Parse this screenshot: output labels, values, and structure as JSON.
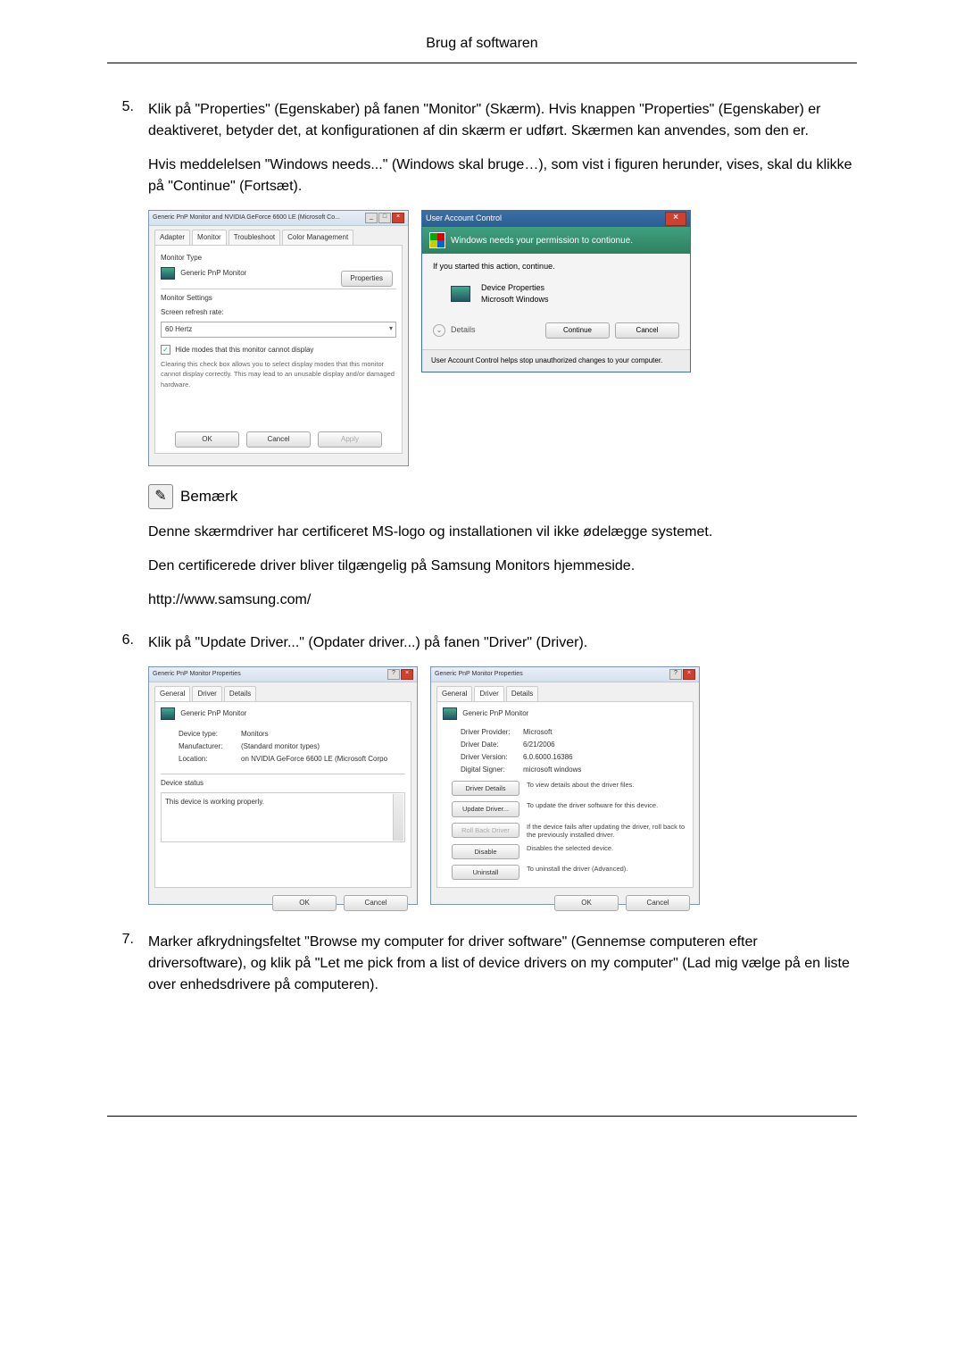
{
  "header": {
    "title": "Brug af softwaren"
  },
  "steps": {
    "s5": {
      "num": "5.",
      "p1": "Klik på \"Properties\" (Egenskaber) på fanen \"Monitor\" (Skærm). Hvis knappen \"Properties\" (Egenskaber) er deaktiveret, betyder det, at konfigurationen af din skærm er udført. Skærmen kan anvendes, som den er.",
      "p2": "Hvis meddelelsen \"Windows needs...\" (Windows skal bruge…), som vist i figuren herunder, vises, skal du klikke på \"Continue\" (Fortsæt)."
    },
    "s6": {
      "num": "6.",
      "p1": "Klik på \"Update Driver...\" (Opdater driver...) på fanen \"Driver\" (Driver)."
    },
    "s7": {
      "num": "7.",
      "p1": "Marker afkrydningsfeltet \"Browse my computer for driver software\" (Gennemse computeren efter driversoftware), og klik på \"Let me pick from a list of device drivers on my computer\" (Lad mig vælge på en liste over enhedsdrivere på computeren)."
    }
  },
  "dlg1": {
    "title": "Generic PnP Monitor and NVIDIA GeForce 6600 LE (Microsoft Co...",
    "tabs": [
      "Adapter",
      "Monitor",
      "Troubleshoot",
      "Color Management"
    ],
    "monitorType": "Monitor Type",
    "monitorName": "Generic PnP Monitor",
    "propertiesBtn": "Properties",
    "monitorSettings": "Monitor Settings",
    "refreshLabel": "Screen refresh rate:",
    "refreshValue": "60 Hertz",
    "hideModes": "Hide modes that this monitor cannot display",
    "hideDesc": "Clearing this check box allows you to select display modes that this monitor cannot display correctly. This may lead to an unusable display and/or damaged hardware.",
    "ok": "OK",
    "cancel": "Cancel",
    "apply": "Apply"
  },
  "uac": {
    "title": "User Account Control",
    "banner": "Windows needs your permission to contionue.",
    "msg": "If you started this action, continue.",
    "appName": "Device Properties",
    "appVendor": "Microsoft Windows",
    "details": "Details",
    "continue": "Continue",
    "cancel": "Cancel",
    "footer": "User Account Control helps stop unauthorized changes to your computer."
  },
  "note": {
    "label": "Bemærk",
    "p1": "Denne skærmdriver har certificeret MS-logo og installationen vil ikke ødelægge systemet.",
    "p2": "Den certificerede driver bliver tilgængelig på Samsung Monitors hjemmeside.",
    "url": "http://www.samsung.com/"
  },
  "dlg2": {
    "title": "Generic PnP Monitor Properties",
    "tabs": [
      "General",
      "Driver",
      "Details"
    ],
    "monitorName": "Generic PnP Monitor",
    "deviceTypeK": "Device type:",
    "deviceTypeV": "Monitors",
    "manufacturerK": "Manufacturer:",
    "manufacturerV": "(Standard monitor types)",
    "locationK": "Location:",
    "locationV": "on NVIDIA GeForce 6600 LE (Microsoft Corpo",
    "statusLabel": "Device status",
    "statusText": "This device is working properly.",
    "ok": "OK",
    "cancel": "Cancel"
  },
  "dlg3": {
    "title": "Generic PnP Monitor Properties",
    "tabs": [
      "General",
      "Driver",
      "Details"
    ],
    "monitorName": "Generic PnP Monitor",
    "providerK": "Driver Provider:",
    "providerV": "Microsoft",
    "dateK": "Driver Date:",
    "dateV": "6/21/2006",
    "versionK": "Driver Version:",
    "versionV": "6.0.6000.16386",
    "signerK": "Digital Signer:",
    "signerV": "microsoft windows",
    "btn_details": "Driver Details",
    "desc_details": "To view details about the driver files.",
    "btn_update": "Update Driver...",
    "desc_update": "To update the driver software for this device.",
    "btn_rollback": "Roll Back Driver",
    "desc_rollback": "If the device fails after updating the driver, roll back to the previously installed driver.",
    "btn_disable": "Disable",
    "desc_disable": "Disables the selected device.",
    "btn_uninstall": "Uninstall",
    "desc_uninstall": "To uninstall the driver (Advanced).",
    "ok": "OK",
    "cancel": "Cancel"
  }
}
